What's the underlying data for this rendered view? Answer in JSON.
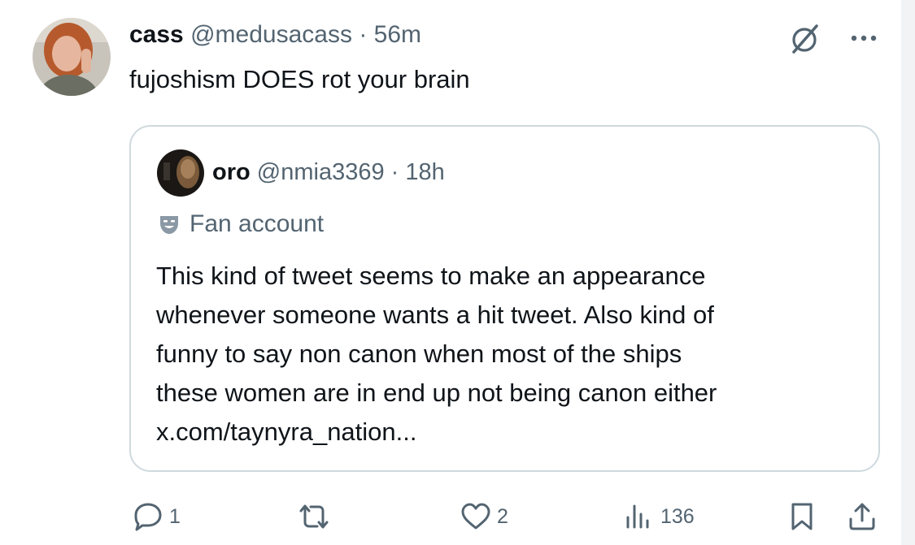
{
  "tweet": {
    "author_name": "cass",
    "handle": "@medusacass",
    "separator": "·",
    "time": "56m",
    "text": "fujoshism DOES rot your brain"
  },
  "quote": {
    "author_name": "oro",
    "handle": "@nmia3369",
    "separator": "·",
    "time": "18h",
    "label": "Fan account",
    "lines": [
      "This kind of tweet seems to make an appearance",
      "whenever someone wants a hit tweet. Also kind of",
      "funny to say non canon when most of the ships",
      "these women are in end up not being canon either",
      "x.com/taynyra_nation..."
    ]
  },
  "actions": {
    "replies": "1",
    "reposts": "",
    "likes": "2",
    "views": "136"
  },
  "colors": {
    "text_primary": "#0f1419",
    "text_secondary": "#536471",
    "border": "#cfd9de",
    "background": "#ffffff"
  },
  "icons": [
    "grok-icon",
    "more-icon",
    "fan-account-icon",
    "reply-icon",
    "repost-icon",
    "like-icon",
    "views-icon",
    "bookmark-icon",
    "share-icon"
  ]
}
